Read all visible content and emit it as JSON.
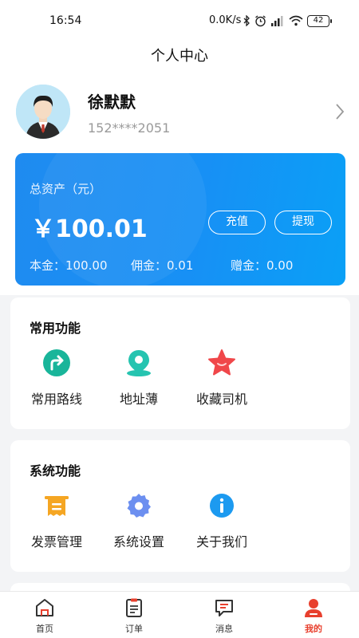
{
  "status_bar": {
    "time": "16:54",
    "network_speed": "0.0K/s",
    "battery_level": "42"
  },
  "header": {
    "title": "个人中心"
  },
  "profile": {
    "name": "徐默默",
    "phone": "152****2051"
  },
  "asset_card": {
    "label": "总资产（元）",
    "amount": "￥100.01",
    "recharge_label": "充值",
    "withdraw_label": "提现",
    "principal": "本金：100.00",
    "commission": "佣金：0.01",
    "gift": "赠金：0.00",
    "colors": {
      "start": "#1f8bf0",
      "end": "#0aa0f6"
    }
  },
  "common_functions": {
    "title": "常用功能",
    "items": [
      {
        "label": "常用路线",
        "icon": "route-icon",
        "color": "#19b59a"
      },
      {
        "label": "地址薄",
        "icon": "location-pin-icon",
        "color": "#26c4b0"
      },
      {
        "label": "收藏司机",
        "icon": "star-icon",
        "color": "#f0474a"
      }
    ]
  },
  "system_functions": {
    "title": "系统功能",
    "items": [
      {
        "label": "发票管理",
        "icon": "invoice-icon",
        "color": "#f5a623"
      },
      {
        "label": "系统设置",
        "icon": "settings-icon",
        "color": "#6c8ff0"
      },
      {
        "label": "关于我们",
        "icon": "info-icon",
        "color": "#1c9af0"
      }
    ]
  },
  "tab_bar": {
    "items": [
      {
        "label": "首页",
        "icon": "home-icon"
      },
      {
        "label": "订单",
        "icon": "order-icon"
      },
      {
        "label": "消息",
        "icon": "message-icon"
      },
      {
        "label": "我的",
        "icon": "profile-icon",
        "active": true
      }
    ],
    "active_color": "#e8402e"
  }
}
